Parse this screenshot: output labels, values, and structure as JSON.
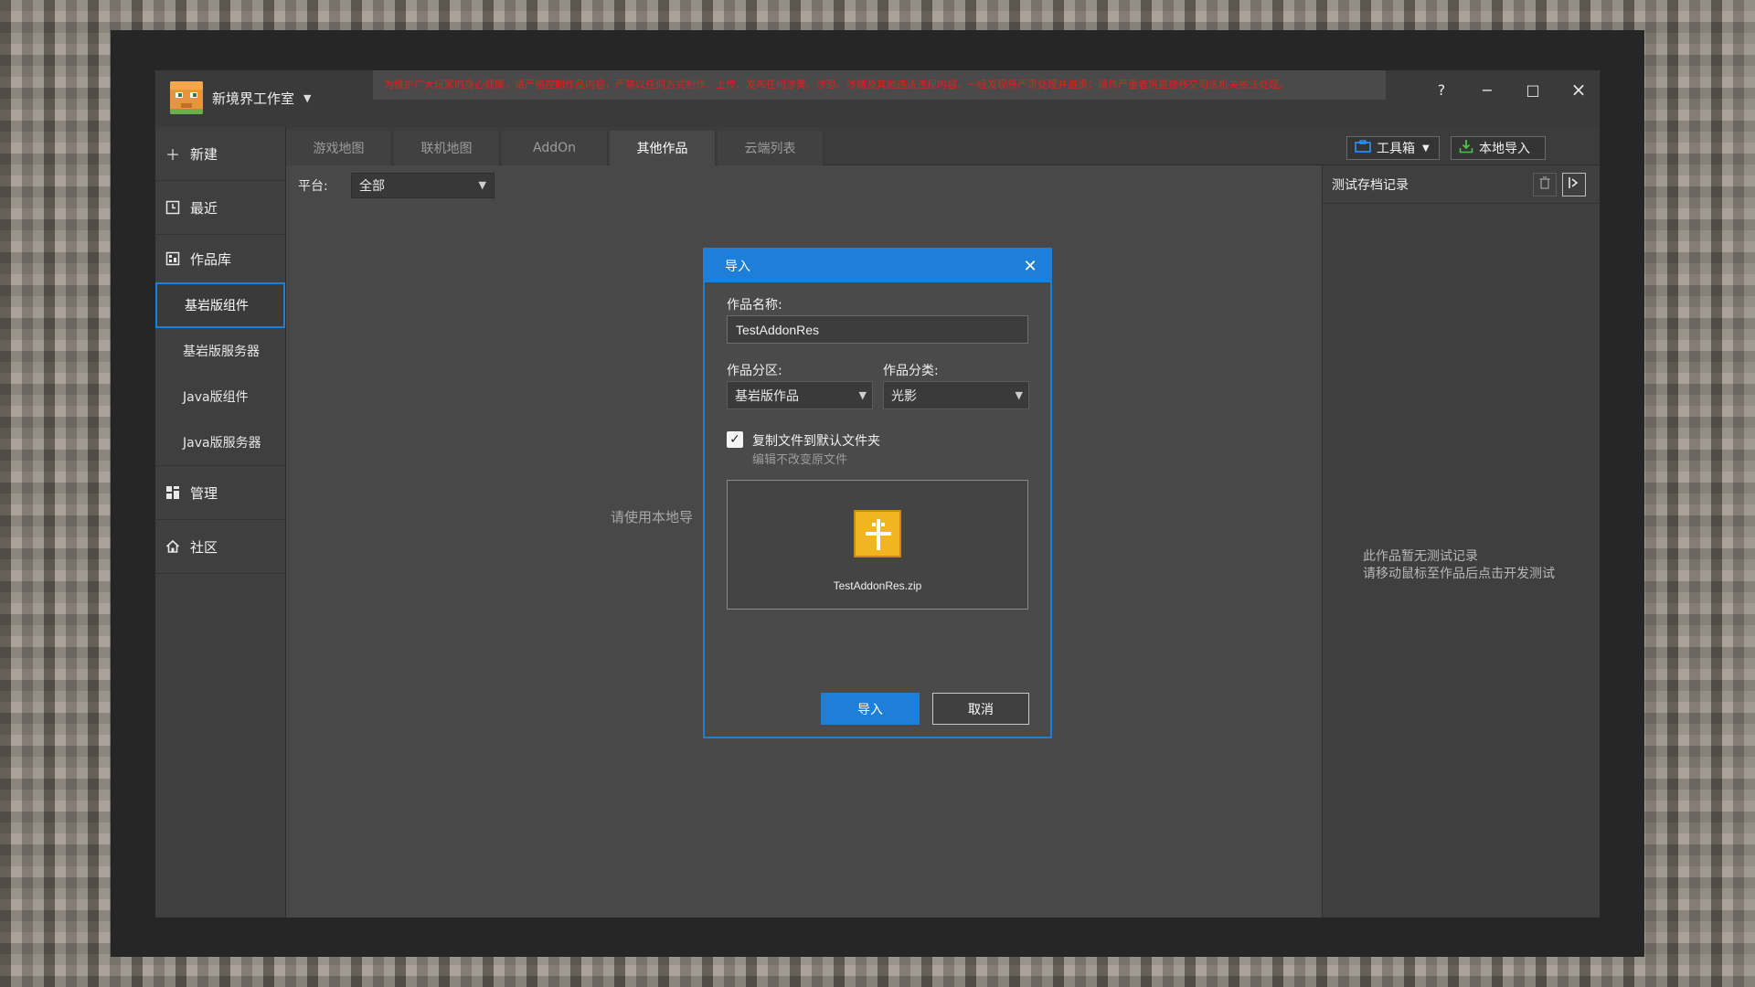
{
  "app": {
    "studio_name": "新境界工作室",
    "notice": "为维护广大玩家的身心健康，请严格控制作品内容，严禁以任何方式制作、上传、发布任何涉黄、涉恐、涉赌及其他违法违规内容，一经发现将严肃处理并追责；请作严重者将直接移交司法机关依法处理。"
  },
  "window": {
    "help": "?",
    "minimize": "−",
    "maximize": "□",
    "close": "×"
  },
  "sidebar": {
    "new": "新建",
    "recent": "最近",
    "library": "作品库",
    "sub_items": [
      "基岩版组件",
      "基岩版服务器",
      "Java版组件",
      "Java版服务器"
    ],
    "manage": "管理",
    "community": "社区"
  },
  "tabs": [
    "游戏地图",
    "联机地图",
    "AddOn",
    "其他作品",
    "云端列表"
  ],
  "toolbar": {
    "toolbox": "工具箱",
    "local_import": "本地导入"
  },
  "filter": {
    "label": "平台:",
    "value": "全部"
  },
  "main": {
    "hint": "请使用本地导"
  },
  "right_panel": {
    "title": "测试存档记录",
    "empty_line1": "此作品暂无测试记录",
    "empty_line2": "请移动鼠标至作品后点击开发测试"
  },
  "dialog": {
    "title": "导入",
    "name_label": "作品名称:",
    "name_value": "TestAddonRes",
    "zone_label": "作品分区:",
    "zone_value": "基岩版作品",
    "category_label": "作品分类:",
    "category_value": "光影",
    "copy_checked": true,
    "copy_label": "复制文件到默认文件夹",
    "copy_hint": "编辑不改变原文件",
    "file_name": "TestAddonRes.zip",
    "import_button": "导入",
    "cancel_button": "取消"
  },
  "colors": {
    "accent": "#1e7fd8",
    "notice_text": "#e0201c",
    "file_icon": "#f2b520"
  }
}
